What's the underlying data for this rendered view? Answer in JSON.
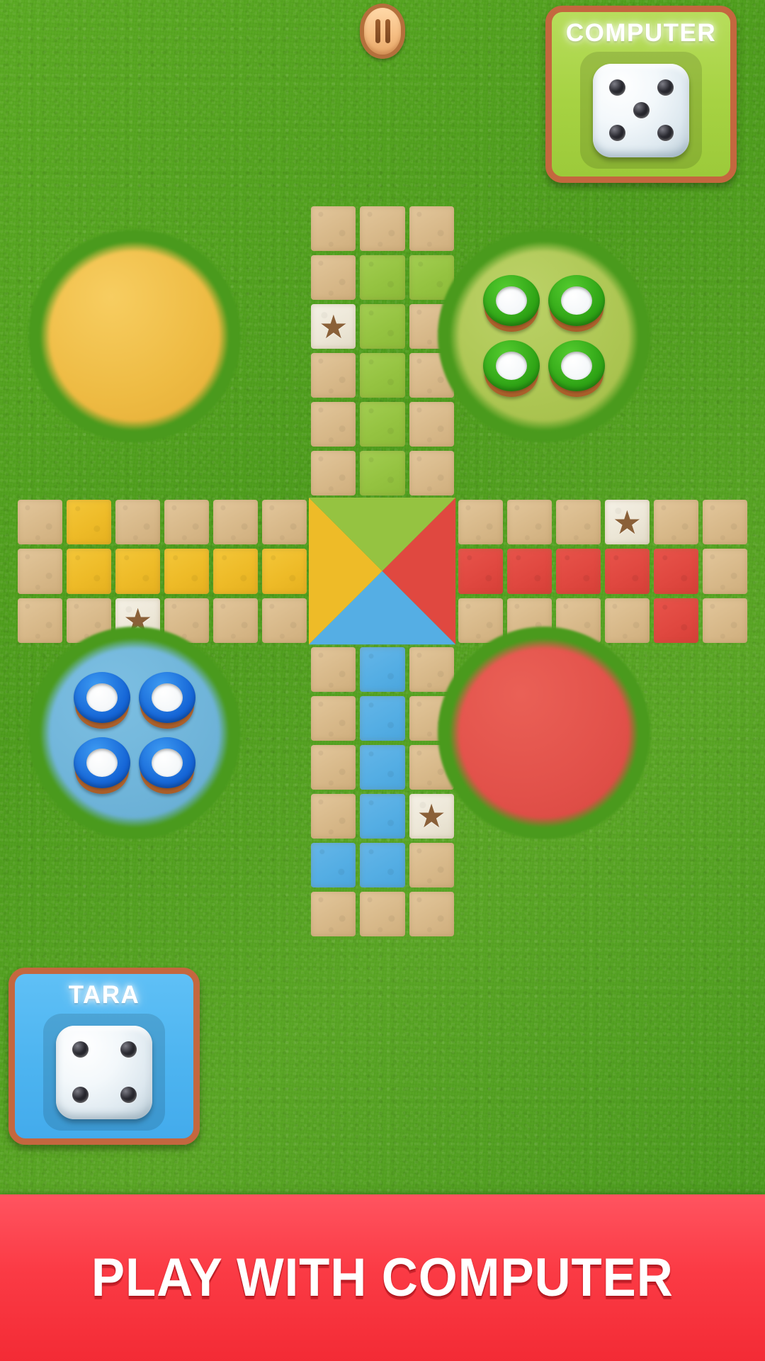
{
  "screen": {
    "title": "Ludo game board",
    "background_color": "#4d9b1e"
  },
  "pause_button": {
    "name": "pause",
    "icon": "pause-icon",
    "label": ""
  },
  "players": [
    {
      "id": "computer",
      "name": "COMPUTER",
      "color": "#a6d242",
      "border_color": "#c4673f",
      "dice_value": 5,
      "position": "top-right",
      "active": false
    },
    {
      "id": "tara",
      "name": "TARA",
      "color": "#4db4f0",
      "border_color": "#c4673f",
      "dice_value": 4,
      "position": "bottom-left",
      "active": true
    }
  ],
  "board": {
    "size": 15,
    "tile_color": "#d8b98a",
    "grass_color": "#4a9a1d",
    "star_tile_color": "#ece6d6",
    "star_glyph": "★",
    "colors": {
      "yellow": "#eebb28",
      "green": "#95c341",
      "red": "#e04840",
      "blue": "#55aee4"
    },
    "yards": [
      {
        "id": "yard-yellow",
        "color": "#eebb43",
        "corner": "top-left",
        "tokens": 0,
        "token_color": "#eebb43"
      },
      {
        "id": "yard-green",
        "color": "#adc653",
        "corner": "top-right",
        "tokens": 4,
        "token_color": "#2ea315"
      },
      {
        "id": "yard-blue",
        "color": "#6fb4d9",
        "corner": "bottom-left",
        "tokens": 4,
        "token_color": "#1565d6"
      },
      {
        "id": "yard-red",
        "color": "#e2514a",
        "corner": "bottom-right",
        "tokens": 0,
        "token_color": "#e2514a"
      }
    ],
    "center_triangles": [
      {
        "side": "left",
        "color": "#eebb28"
      },
      {
        "side": "top",
        "color": "#95c341"
      },
      {
        "side": "right",
        "color": "#e04840"
      },
      {
        "side": "bottom",
        "color": "#55aee4"
      }
    ],
    "star_cells": [
      {
        "col": 6,
        "row": 2,
        "name": "star-safe-top"
      },
      {
        "col": 12,
        "row": 6,
        "name": "star-safe-right"
      },
      {
        "col": 2,
        "row": 8,
        "name": "star-safe-left"
      },
      {
        "col": 8,
        "row": 12,
        "name": "star-safe-bottom"
      }
    ],
    "start_cells": [
      {
        "col": 1,
        "row": 6,
        "color": "yellow",
        "name": "start-yellow"
      },
      {
        "col": 8,
        "row": 1,
        "color": "green",
        "name": "start-green"
      },
      {
        "col": 13,
        "row": 8,
        "color": "red",
        "name": "start-red"
      },
      {
        "col": 6,
        "row": 13,
        "color": "blue",
        "name": "start-blue"
      }
    ],
    "home_paths": [
      {
        "color": "yellow",
        "row": 7,
        "cols": [
          1,
          2,
          3,
          4,
          5
        ],
        "name": "home-path-yellow"
      },
      {
        "color": "green",
        "col": 7,
        "rows": [
          1,
          2,
          3,
          4,
          5
        ],
        "name": "home-path-green"
      },
      {
        "color": "red",
        "row": 7,
        "cols": [
          9,
          10,
          11,
          12,
          13
        ],
        "name": "home-path-red"
      },
      {
        "color": "blue",
        "col": 7,
        "rows": [
          9,
          10,
          11,
          12,
          13
        ],
        "name": "home-path-blue"
      }
    ]
  },
  "banner": {
    "text": "PLAY WITH COMPUTER",
    "background_color": "#fb3b45",
    "text_color": "#ffffff"
  }
}
